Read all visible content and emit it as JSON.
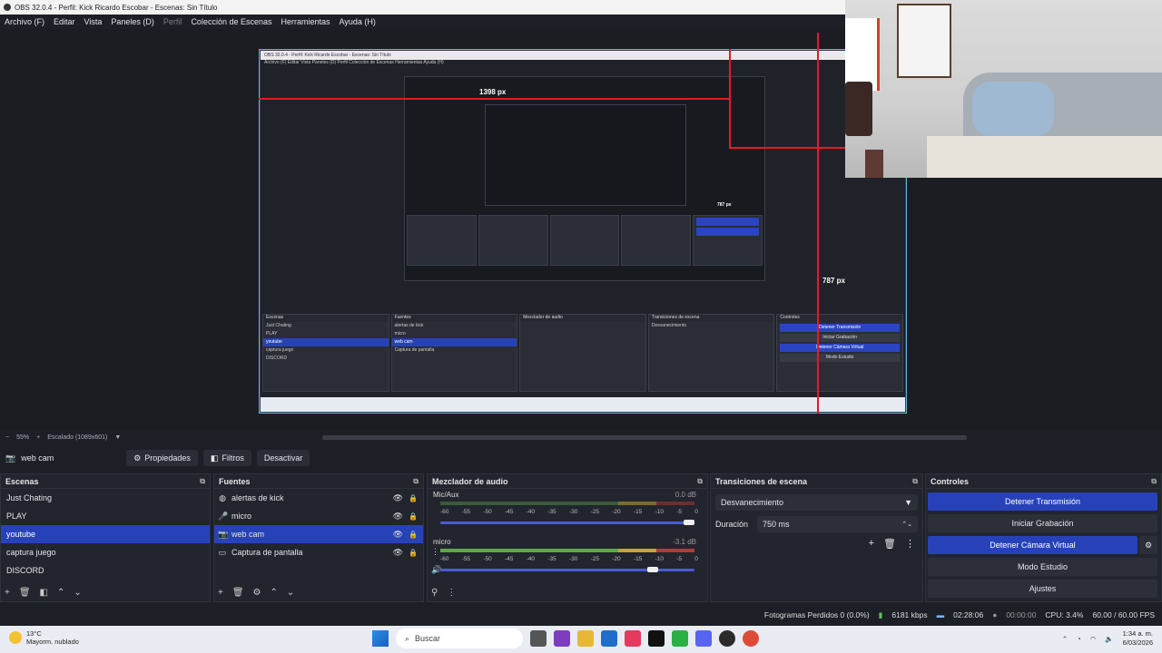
{
  "window": {
    "title": "OBS 32.0.4 - Perfil: Kick Ricardo Escobar - Escenas: Sin Título"
  },
  "menu": [
    {
      "label": "Archivo (F)",
      "dim": false
    },
    {
      "label": "Editar",
      "dim": false
    },
    {
      "label": "Vista",
      "dim": false
    },
    {
      "label": "Paneles (D)",
      "dim": false
    },
    {
      "label": "Perfil",
      "dim": true
    },
    {
      "label": "Colección de Escenas",
      "dim": false
    },
    {
      "label": "Herramientas",
      "dim": false
    },
    {
      "label": "Ayuda (H)",
      "dim": false
    }
  ],
  "preview": {
    "width_label": "1398 px",
    "height_label_inner": "787 px",
    "height_label": "787 px",
    "nested_title": "OBS 32.0.4 - Perfil: Kick Ricardo Escobar - Escenas: Sin Título",
    "nested_menu": "Archivo (F)   Editar   Vista   Paneles (D)   Perfil   Colección de Escenas   Herramientas   Ayuda (H)"
  },
  "zoom": {
    "minus": "−",
    "value": "55%",
    "plus": "+",
    "scaling": "Escalado (1089x601)"
  },
  "sourcebar": {
    "source_name": "web cam",
    "properties": "Propiedades",
    "filters": "Filtros",
    "deactivate": "Desactivar"
  },
  "scenes": {
    "title": "Escenas",
    "items": [
      "Just Chating",
      "PLAY",
      "youtube",
      "captura juego",
      "DISCORD"
    ],
    "selected": 2
  },
  "sources": {
    "title": "Fuentes",
    "items": [
      {
        "label": "alertas de kick",
        "icon": "globe-icon"
      },
      {
        "label": "micro",
        "icon": "microphone-icon"
      },
      {
        "label": "web cam",
        "icon": "camera-icon"
      },
      {
        "label": "Captura de pantalla",
        "icon": "monitor-icon"
      }
    ],
    "selected": 2
  },
  "mixer": {
    "title": "Mezclador de audio",
    "channels": [
      {
        "name": "Mic/Aux",
        "db": "0.0 dB"
      },
      {
        "name": "micro",
        "db": "-3.1 dB"
      }
    ],
    "ticks": [
      "-60",
      "-55",
      "-50",
      "-45",
      "-40",
      "-35",
      "-30",
      "-25",
      "-20",
      "-15",
      "-10",
      "-5",
      "0"
    ]
  },
  "transitions": {
    "title": "Transiciones de escena",
    "selected": "Desvanecimiento",
    "duration_label": "Duración",
    "duration_value": "750 ms"
  },
  "controls": {
    "title": "Controles",
    "stop_stream": "Detener Transmisión",
    "start_record": "Iniciar Grabación",
    "stop_virtual_cam": "Detener Cámara Virtual",
    "studio_mode": "Modo Estudio",
    "settings": "Ajustes"
  },
  "status": {
    "dropped_frames": "Fotogramas Perdidos 0 (0.0%)",
    "bitrate": "6181 kbps",
    "stream_time": "02:28:06",
    "record_time": "00:00:00",
    "cpu": "CPU: 3.4%",
    "fps": "60.00 / 60.00 FPS"
  },
  "taskbar": {
    "temp": "13°C",
    "weather": "Mayorm. nublado",
    "search": "Buscar",
    "time": "1:34 a. m.",
    "date": "6/03/2026"
  },
  "colors": {
    "accent": "#2742b9",
    "red_guides": "#e21c22",
    "preview_border": "#5fb7d6"
  }
}
